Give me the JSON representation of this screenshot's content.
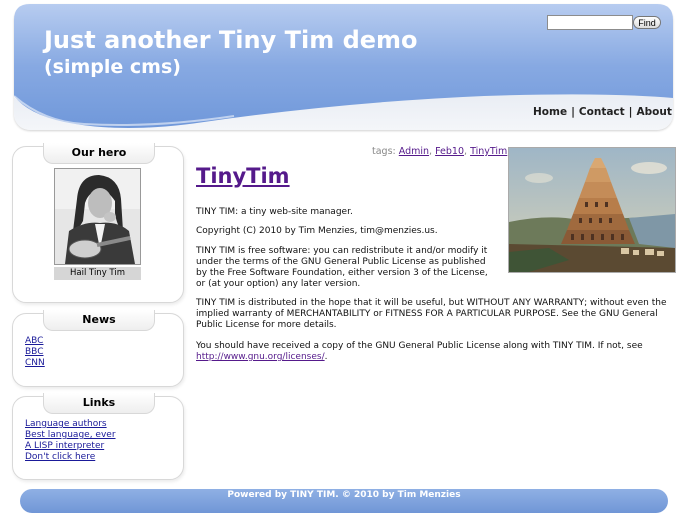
{
  "header": {
    "title": "Just another Tiny Tim demo",
    "subtitle": "(simple cms)",
    "search": {
      "placeholder": "",
      "value": ""
    },
    "find_label": "Find",
    "nav": [
      {
        "label": "Home"
      },
      {
        "label": "Contact"
      },
      {
        "label": "About"
      }
    ],
    "nav_separator": "|",
    "colors": {
      "wave": "#7da2e0",
      "wave_light": "#a9c2ee"
    }
  },
  "sidebar": {
    "hero": {
      "title": "Our hero",
      "caption": "Hail Tiny Tim"
    },
    "news": {
      "title": "News",
      "links": [
        "ABC",
        "BBC",
        "CNN"
      ]
    },
    "links": {
      "title": "Links",
      "items": [
        "Language authors",
        "Best language, ever",
        "A LISP interpreter",
        "Don't click here"
      ]
    }
  },
  "main": {
    "tags_label": "tags:",
    "tags": [
      "Admin",
      "Feb10",
      "TinyTim"
    ],
    "post_title": "TinyTim",
    "para1": "TINY TIM: a tiny web-site manager.",
    "para2": "Copyright (C) 2010 by Tim Menzies, tim@menzies.us.",
    "para3": "TINY TIM is free software: you can redistribute it and/or modify it under the terms of the GNU General Public License as published by the Free Software Foundation, either version 3 of the License, or (at your option) any later version.",
    "para4": "TINY TIM is distributed in the hope that it will be useful, but WITHOUT ANY WARRANTY; without even the implied warranty of MERCHANTABILITY or FITNESS FOR A PARTICULAR PURPOSE. See the GNU General Public License for more details.",
    "para5_text": "You should have received a copy of the GNU General Public License along with TINY TIM. If not, see",
    "para5_link": "http://www.gnu.org/licenses/",
    "para5_end": "."
  },
  "footer": {
    "text": "Powered by TINY TIM. © 2010 by Tim Menzies"
  }
}
